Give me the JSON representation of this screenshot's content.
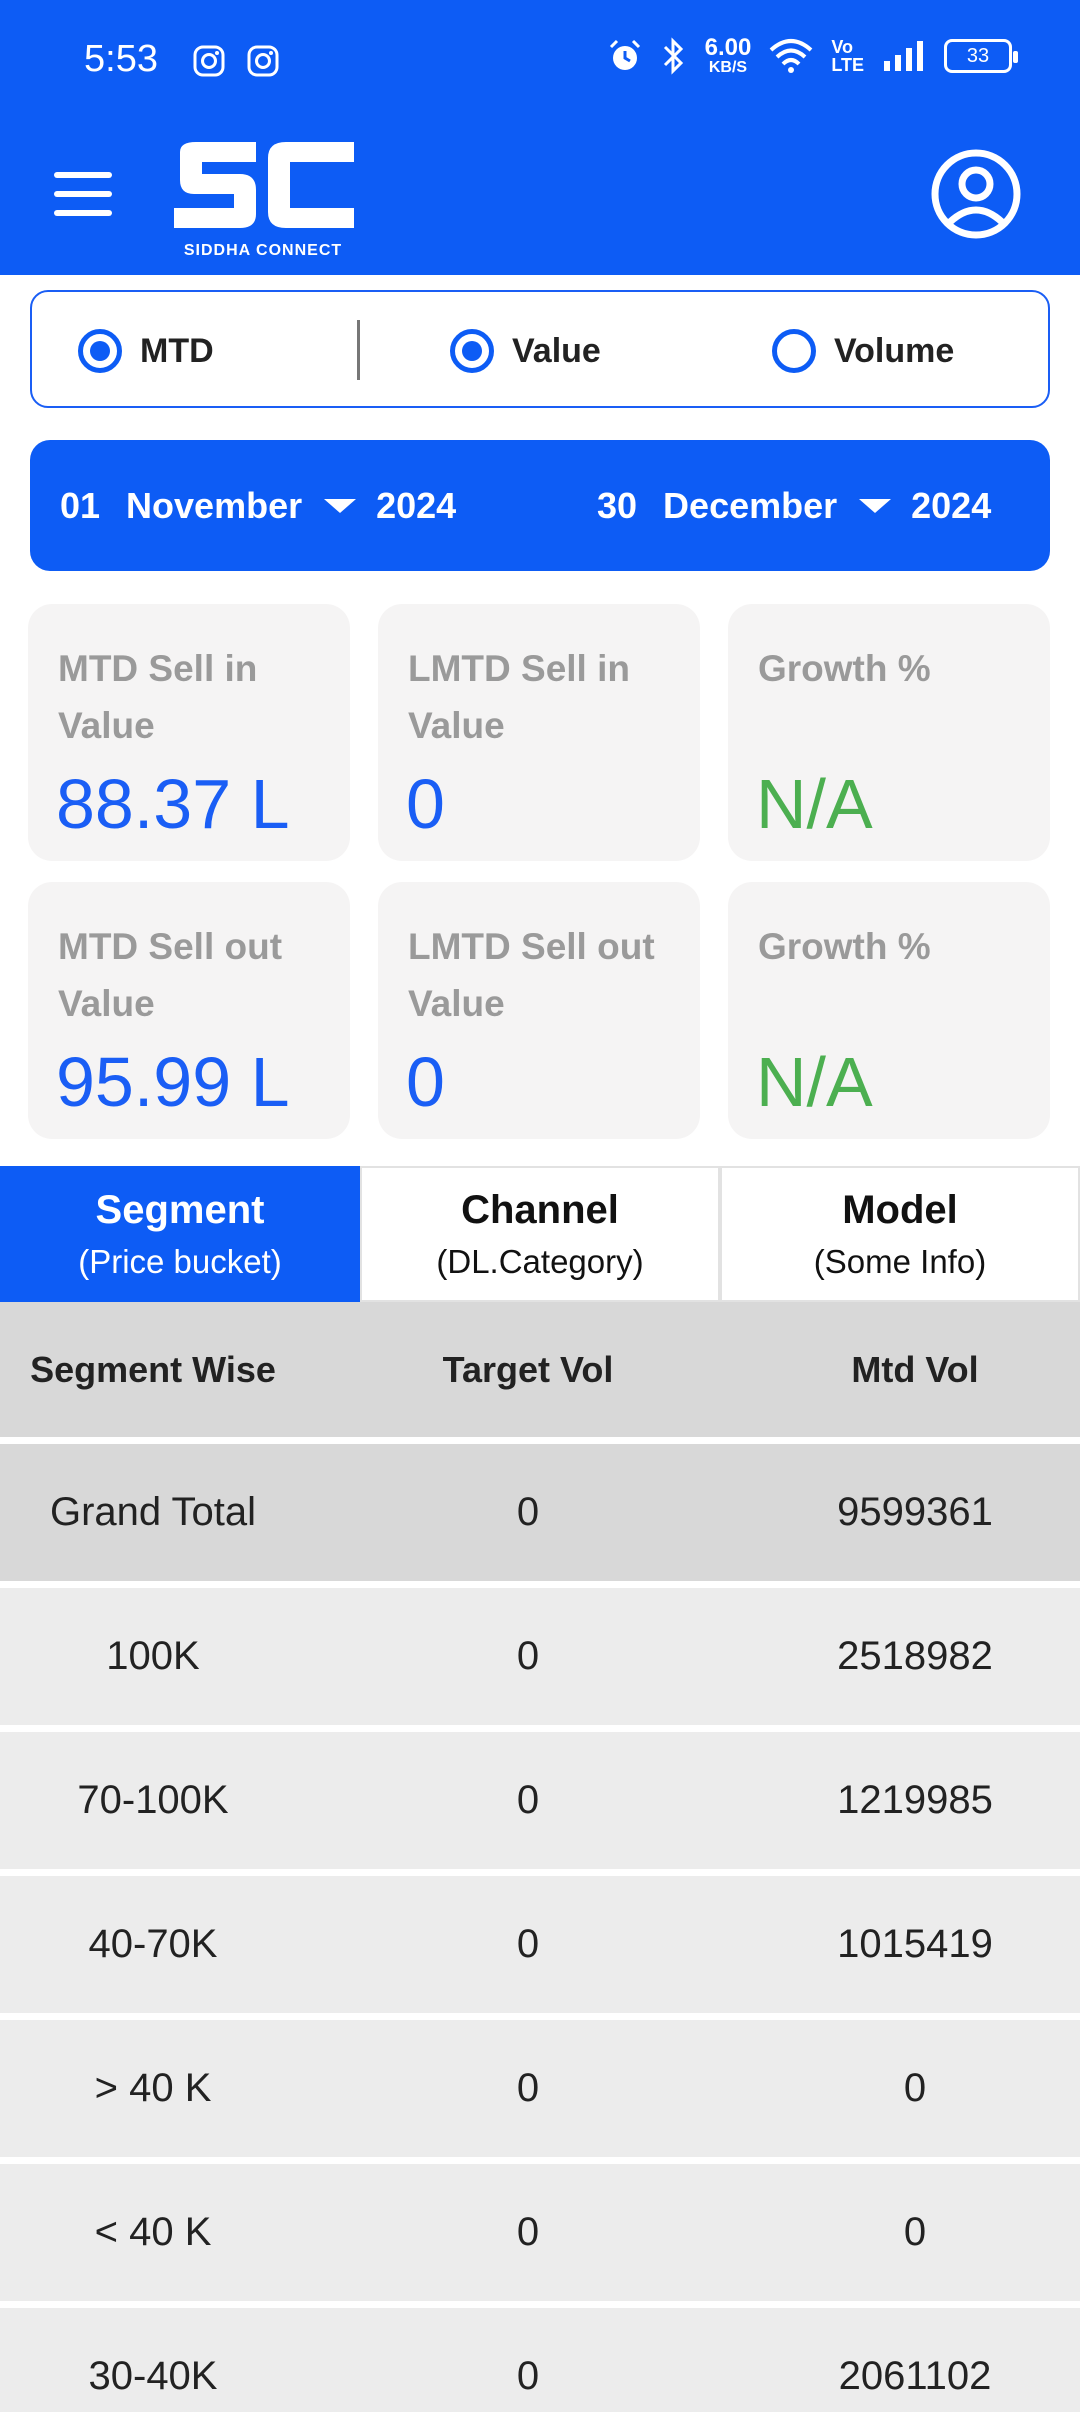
{
  "status_bar": {
    "time": "5:53",
    "net_speed_value": "6.00",
    "net_speed_unit": "KB/S",
    "volte_top": "Vo",
    "volte_bottom": "LTE",
    "battery": "33"
  },
  "app_bar": {
    "logo_text": "SIDDHA CONNECT",
    "logo_letters": "SC"
  },
  "toggles": {
    "period": "MTD",
    "value": "Value",
    "volume": "Volume"
  },
  "date_range": {
    "start": {
      "day": "01",
      "month": "November",
      "year": "2024"
    },
    "end": {
      "day": "30",
      "month": "December",
      "year": "2024"
    }
  },
  "metrics": [
    {
      "label": "MTD Sell in Value",
      "value": "88.37 L"
    },
    {
      "label": "LMTD Sell in Value",
      "value": "0"
    },
    {
      "label": "Growth %",
      "value": "N/A"
    },
    {
      "label": "MTD Sell out Value",
      "value": "95.99 L"
    },
    {
      "label": "LMTD Sell out Value",
      "value": "0"
    },
    {
      "label": "Growth %",
      "value": "N/A"
    }
  ],
  "tabs": [
    {
      "title": "Segment",
      "subtitle": "(Price bucket)"
    },
    {
      "title": "Channel",
      "subtitle": "(DL.Category)"
    },
    {
      "title": "Model",
      "subtitle": "(Some Info)"
    }
  ],
  "table": {
    "headers": [
      "Segment Wise",
      "Target Vol",
      "Mtd Vol"
    ],
    "rows": [
      [
        "Grand Total",
        "0",
        "9599361"
      ],
      [
        "100K",
        "0",
        "2518982"
      ],
      [
        "70-100K",
        "0",
        "1219985"
      ],
      [
        "40-70K",
        "0",
        "1015419"
      ],
      [
        "> 40 K",
        "0",
        "0"
      ],
      [
        "< 40 K",
        "0",
        "0"
      ],
      [
        "30-40K",
        "0",
        "2061102"
      ]
    ]
  },
  "colors": {
    "primary": "#0d5cf5",
    "value_blue": "#1a5ef5",
    "growth_green": "#4caf50",
    "card_bg": "#f5f4f4"
  }
}
